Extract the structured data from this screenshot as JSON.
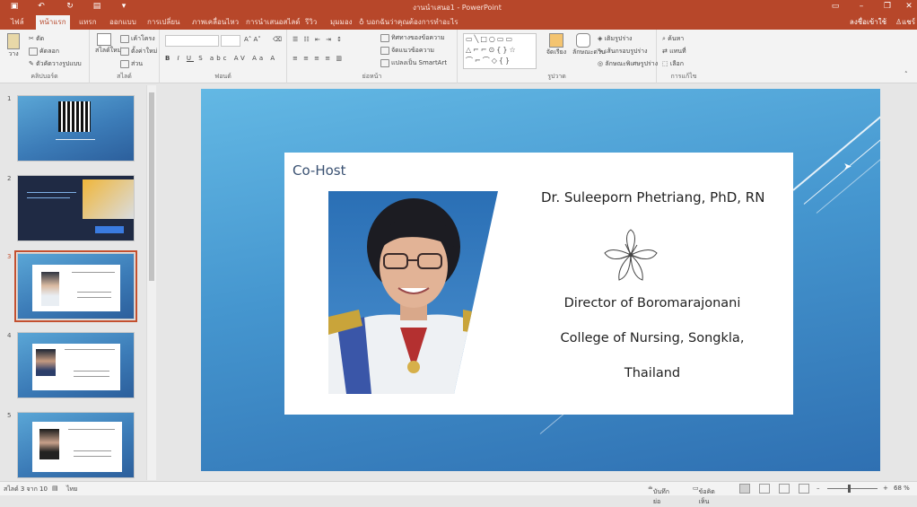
{
  "titlebar": {
    "doc_title": "งานนำเสนอ1 - PowerPoint",
    "quick_access": [
      "save",
      "undo",
      "redo",
      "present"
    ],
    "window_buttons": [
      "ribbon-options",
      "minimize",
      "restore",
      "close"
    ]
  },
  "tabs": [
    {
      "label": "ไฟล์"
    },
    {
      "label": "หน้าแรก",
      "active": true
    },
    {
      "label": "แทรก"
    },
    {
      "label": "ออกแบบ"
    },
    {
      "label": "การเปลี่ยน"
    },
    {
      "label": "ภาพเคลื่อนไหว"
    },
    {
      "label": "การนำเสนอสไลด์"
    },
    {
      "label": "รีวิว"
    },
    {
      "label": "มุมมอง"
    }
  ],
  "tellme": "บอกฉันว่าคุณต้องการทำอะไร",
  "user": "ลงชื่อเข้าใช้",
  "share": "แชร์",
  "ribbon": {
    "groups": [
      {
        "label": "คลิปบอร์ด"
      },
      {
        "label": "สไลด์"
      },
      {
        "label": "ฟอนต์"
      },
      {
        "label": "ย่อหน้า"
      },
      {
        "label": "รูปวาด"
      },
      {
        "label": "การแก้ไข"
      }
    ],
    "clipboard": {
      "paste": "วาง",
      "cut": "ตัด",
      "copy": "คัดลอก",
      "format_painter": "ตัวคัดวางรูปแบบ"
    },
    "slides": {
      "new_slide": "สไลด์ใหม่",
      "layout": "เค้าโครง",
      "reset": "ตั้งค่าใหม่",
      "section": "ส่วน"
    },
    "paragraph": {
      "direction": "ทิศทางของข้อความ",
      "align": "จัดแนวข้อความ",
      "smartart": "แปลงเป็น SmartArt"
    },
    "drawing": {
      "arrange": "จัดเรียง",
      "quick_styles": "ลักษณะด่วน",
      "fill": "เติมรูปร่าง",
      "outline": "เส้นกรอบรูปร่าง",
      "effects": "ลักษณะพิเศษรูปร่าง"
    },
    "editing": {
      "find": "ค้นหา",
      "replace": "แทนที่",
      "select": "เลือก"
    }
  },
  "thumbnails": [
    {
      "number": "1"
    },
    {
      "number": "2"
    },
    {
      "number": "3",
      "selected": true
    },
    {
      "number": "4"
    },
    {
      "number": "5"
    }
  ],
  "slide": {
    "cohost_label": "Co-Host",
    "name": "Dr. Suleeporn Phetriang, PhD, RN",
    "role_line1": "Director of Boromarajonani",
    "role_line2": "College of Nursing, Songkla,",
    "role_line3": "Thailand"
  },
  "statusbar": {
    "slide_counter": "สไลด์ 3 จาก 10",
    "language": "ไทย",
    "notes": "บันทึกย่อ",
    "comments": "ข้อคิดเห็น",
    "zoom": "68 %"
  },
  "colors": {
    "accent": "#b7472a",
    "slide_top": "#63b8e4",
    "slide_bottom": "#2f70b2",
    "card_title": "#3a5172"
  }
}
